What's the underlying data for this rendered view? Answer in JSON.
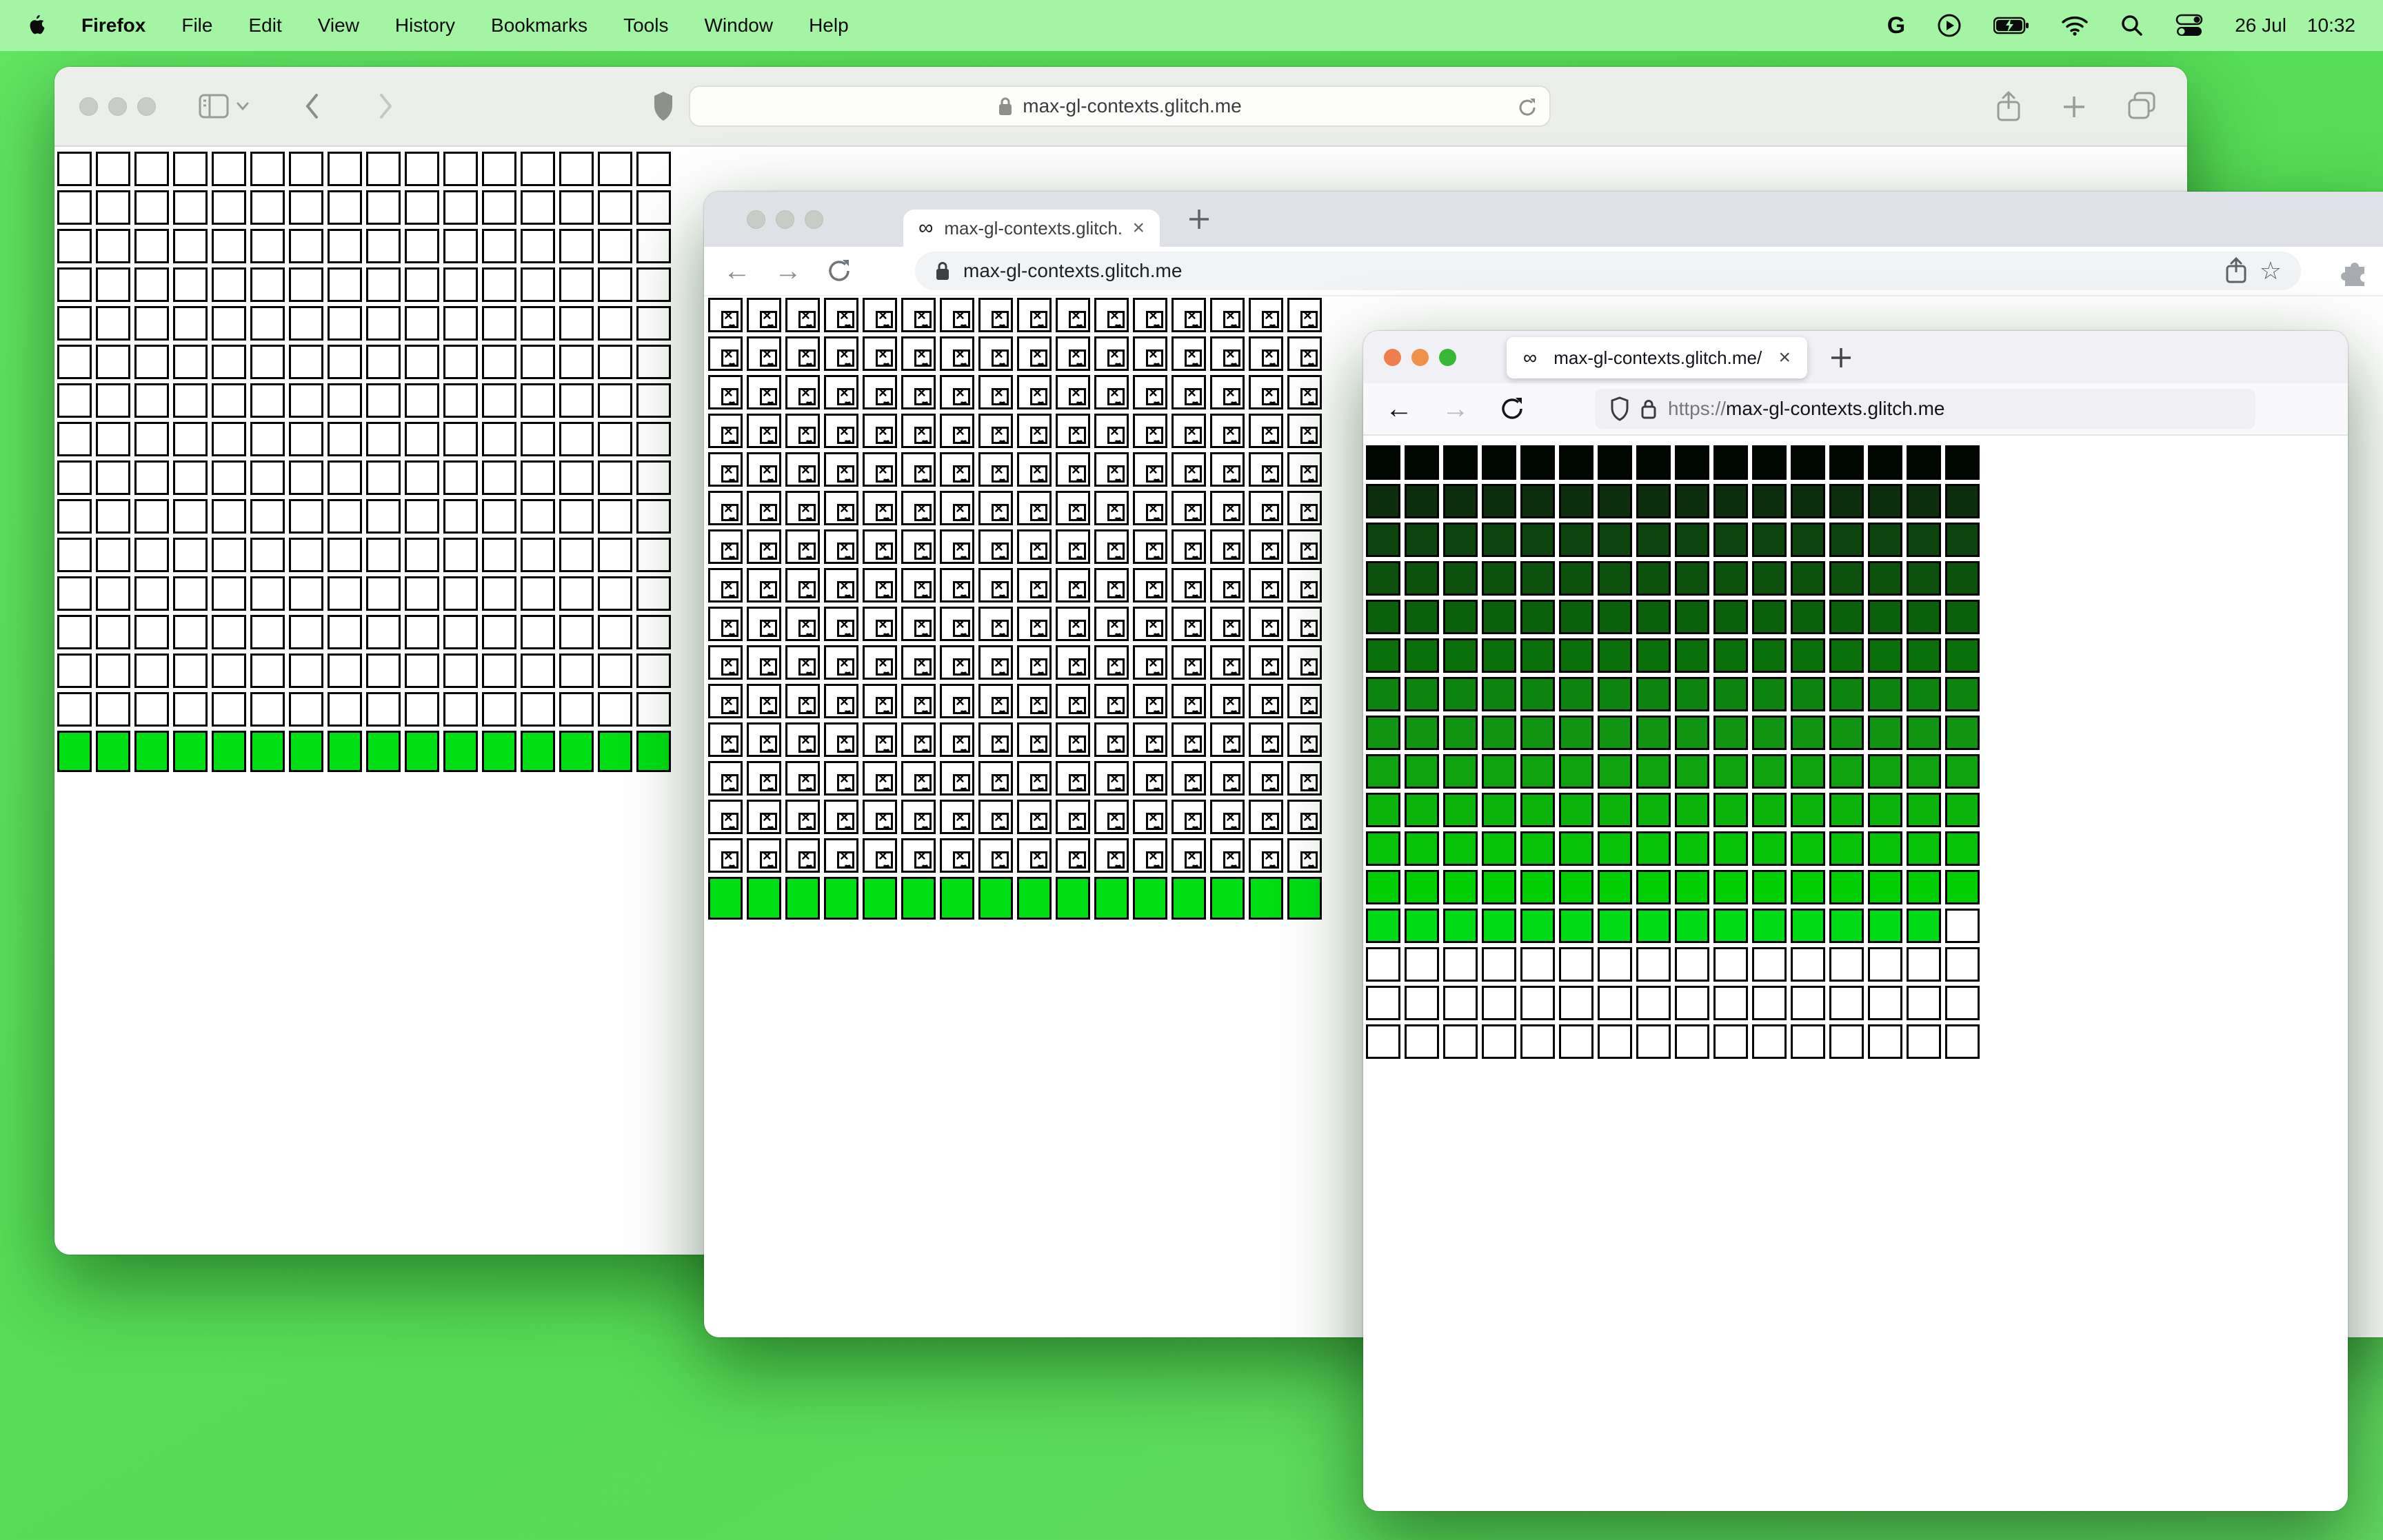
{
  "colors": {
    "desktop": "#58DC58",
    "menu_bar_bg": "#A3F4A3",
    "bright_green": "#00DE14",
    "safari_toolbar": "#ECEFE9",
    "chrome_tabbar": "#DEE1E6",
    "firefox_chrome": "#F1F0F4",
    "inactive_traffic_light": "#C9CBC6",
    "firefox_traffic_lights": [
      "#EE7E4D",
      "#EF914C",
      "#39B838"
    ]
  },
  "glyphs": {
    "infinity": "∞",
    "close": "×",
    "back_arrow": "←",
    "forward_arrow": "→",
    "star": "☆",
    "google": "G",
    "broken_x": "×"
  },
  "menu_bar": {
    "app_name": "Firefox",
    "items": [
      "File",
      "Edit",
      "View",
      "History",
      "Bookmarks",
      "Tools",
      "Window",
      "Help"
    ],
    "right_icons": [
      "google",
      "play-circle",
      "battery-charging",
      "wifi",
      "spotlight-search",
      "control-center"
    ],
    "date": "26 Jul",
    "time": "10:32"
  },
  "safari": {
    "url": "max-gl-contexts.glitch.me",
    "grid": {
      "cols": 16,
      "green_row_height": 60,
      "rows": [
        {
          "type": "empty",
          "repeat": 15
        },
        {
          "type": "green",
          "repeat": 1
        }
      ]
    }
  },
  "chrome": {
    "tab_title": "max-gl-contexts.glitch.me",
    "url": "max-gl-contexts.glitch.me",
    "grid": {
      "cols": 16,
      "green_row_height": 62,
      "rows": [
        {
          "type": "broken",
          "repeat": 15
        },
        {
          "type": "green",
          "repeat": 1
        }
      ]
    }
  },
  "firefox": {
    "tab_title": "max-gl-contexts.glitch.me/",
    "url_prefix": "https://",
    "url_host": "max-gl-contexts.glitch.me",
    "grid": {
      "cols": 16,
      "rows": [
        {
          "type": "color",
          "color": "#000700"
        },
        {
          "type": "color",
          "color": "#0C2E0C"
        },
        {
          "type": "color",
          "color": "#0D430D"
        },
        {
          "type": "color",
          "color": "#0C520C"
        },
        {
          "type": "color",
          "color": "#0B610B"
        },
        {
          "type": "color",
          "color": "#0A700A"
        },
        {
          "type": "color",
          "color": "#0D840D"
        },
        {
          "type": "color",
          "color": "#119411"
        },
        {
          "type": "color",
          "color": "#0FA30F"
        },
        {
          "type": "color",
          "color": "#0BB30B"
        },
        {
          "type": "color",
          "color": "#06C206"
        },
        {
          "type": "color",
          "color": "#02CF02"
        },
        {
          "type": "color",
          "color": "#00DC16"
        },
        {
          "type": "empty",
          "repeat": 3
        }
      ],
      "overrides": [
        {
          "row": 12,
          "col": 15,
          "type": "empty"
        }
      ]
    }
  }
}
